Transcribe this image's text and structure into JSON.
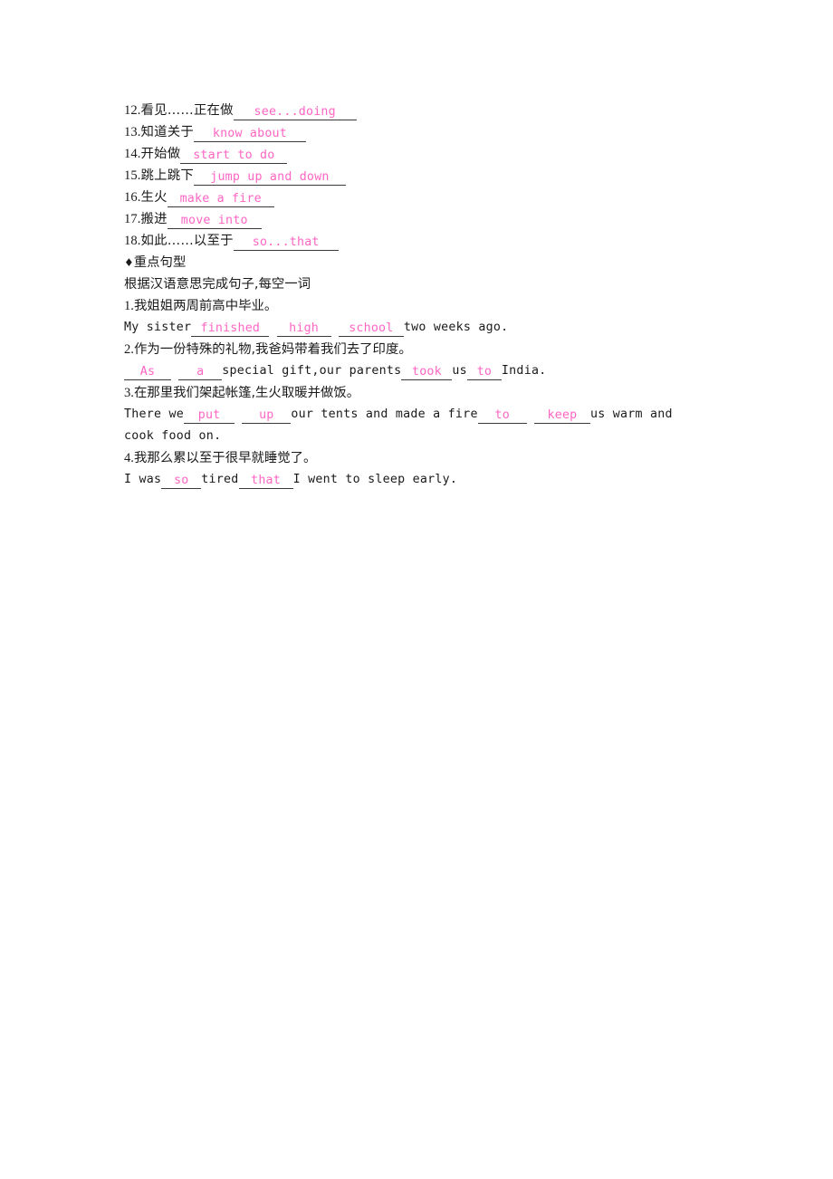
{
  "document": {
    "page_background": "#ffffff",
    "answer_color": "#ff66c4",
    "text_color": "#1a1a1a",
    "blank_rule_color": "#3a3a3a"
  },
  "phrase_list": {
    "items": [
      {
        "number": "12.",
        "prompt": "看见……正在做",
        "answer": "see...doing"
      },
      {
        "number": "13.",
        "prompt": "知道关于",
        "answer": "know about"
      },
      {
        "number": "14.",
        "prompt": "开始做",
        "answer": "start to do"
      },
      {
        "number": "15.",
        "prompt": "跳上跳下",
        "answer": "jump up and down"
      },
      {
        "number": "16.",
        "prompt": "生火",
        "answer": "make a fire"
      },
      {
        "number": "17.",
        "prompt": "搬进",
        "answer": "move into"
      },
      {
        "number": "18.",
        "prompt": "如此……以至于",
        "answer": "so...that"
      }
    ]
  },
  "section": {
    "marker": "♦",
    "heading": "重点句型",
    "instruction": "根据汉语意思完成句子,每空一词"
  },
  "sentences": [
    {
      "number": "1.",
      "chinese": "我姐姐两周前高中毕业。",
      "english": {
        "seg1": "My sister",
        "blank1": "finished",
        "seg2": "",
        "blank2": "high",
        "seg3": "",
        "blank3": "school",
        "seg4": "two weeks ago."
      }
    },
    {
      "number": "2.",
      "chinese": "作为一份特殊的礼物,我爸妈带着我们去了印度。",
      "english": {
        "blank1": "As",
        "seg1": "",
        "blank2": "a",
        "seg2": "special gift,our parents",
        "blank3": "took",
        "seg3": "us",
        "blank4": "to",
        "seg4": "India."
      }
    },
    {
      "number": "3.",
      "chinese": "在那里我们架起帐篷,生火取暖并做饭。",
      "english": {
        "seg1": "There we",
        "blank1": "put",
        "seg2": "",
        "blank2": "up",
        "seg3": "our tents and made a fire",
        "blank3": "to",
        "seg4": "",
        "blank4": "keep",
        "seg5": "us warm and cook food on."
      }
    },
    {
      "number": "4.",
      "chinese": "我那么累以至于很早就睡觉了。",
      "english": {
        "seg1": "I was",
        "blank1": "so",
        "seg2": "tired",
        "blank2": "that",
        "seg3": "I went to sleep early."
      }
    }
  ]
}
